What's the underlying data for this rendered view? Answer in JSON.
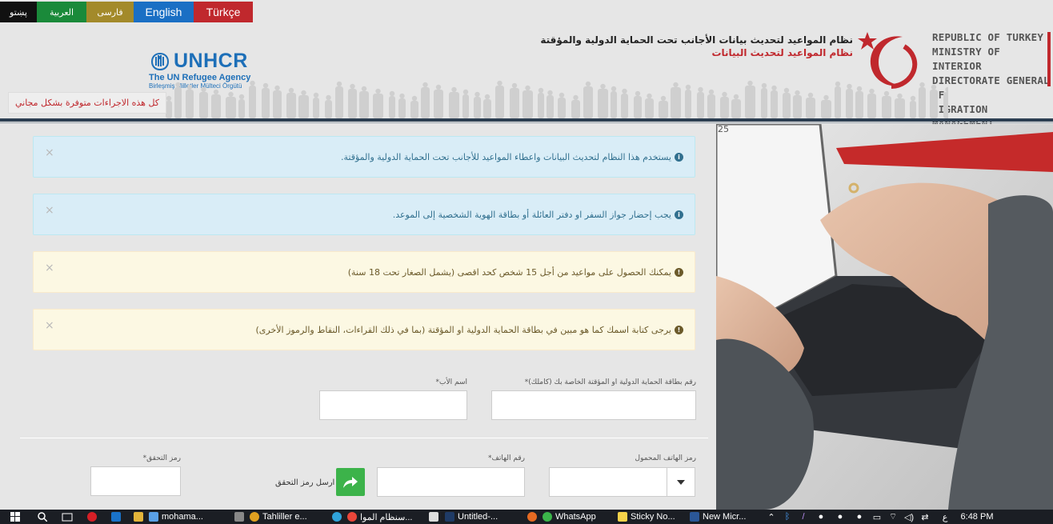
{
  "languages": [
    {
      "key": "ps",
      "label": "پښتو"
    },
    {
      "key": "ar",
      "label": "العربية"
    },
    {
      "key": "fa",
      "label": "فارسی"
    },
    {
      "key": "en",
      "label": "English"
    },
    {
      "key": "tr",
      "label": "Türkçe"
    }
  ],
  "header": {
    "unhcr_name": "UNHCR",
    "unhcr_tagline": "The UN Refugee Agency",
    "unhcr_tagline_tr": "Birleşmiş Milletler Mülteci Örgütü",
    "title_main": "نظام المواعيد لتحديث بيانات الأجانب تحت الحماية الدولية والمؤقتة",
    "title_sub": "نظام المواعيد لتحديث البيانات",
    "ministry_lines": [
      "REPUBLIC OF TURKEY",
      "MINISTRY OF INTERIOR",
      "DIRECTORATE GENERAL OF",
      "MIGRATION MANAGEMENT"
    ],
    "free_notice": "كل هذه الاجراءات متوفرة بشكل مجاني",
    "brand_red": "#c0282d"
  },
  "alerts": [
    {
      "type": "info",
      "text": "يستخدم هذا النظام لتحديث البيانات واعطاء المواعيد للأجانب تحت الحماية الدولية والمؤقتة."
    },
    {
      "type": "info",
      "text": "يجب إحضار جواز السفر او دفتر العائلة أو بطاقة الهوية الشخصية إلى الموعد."
    },
    {
      "type": "warn",
      "text": "يمكنك الحصول على مواعيد من أجل 15 شخص كحد اقصى (يشمل الصغار تحت 18 سنة)"
    },
    {
      "type": "warn",
      "text": "يرجى كتابة اسمك كما هو مبين في بطاقة الحماية الدولية او المؤقتة (بما في ذلك القراءات، النقاط والرموز الأخرى)"
    }
  ],
  "form": {
    "id_label": "رقم بطاقة الحماية الدولية او المؤقتة الخاصة بك (كاملك)*",
    "father_label": "اسم الأب*",
    "mobile_code_label": "رمز الهاتف المحمول",
    "phone_label": "رقم الهاتف*",
    "verify_label": "رمز التحقق*",
    "send_code_label": "ارسل رمز التحقق"
  },
  "taskbar": {
    "items": [
      "mohama...",
      "Tahliller e...",
      "سنظام الموا...",
      "Untitled-...",
      "WhatsApp",
      "Sticky No...",
      "New Micr..."
    ],
    "time": "6:48 PM",
    "lang_indicator": "ع"
  }
}
